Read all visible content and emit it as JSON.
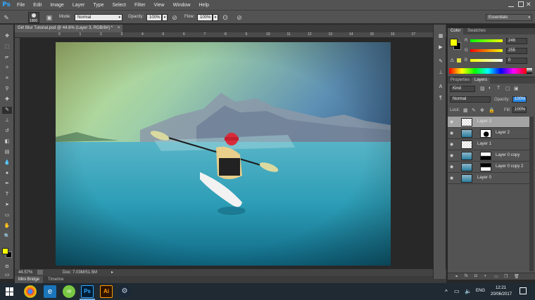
{
  "menubar": {
    "logo": "Ps",
    "items": [
      "File",
      "Edit",
      "Image",
      "Layer",
      "Type",
      "Select",
      "Filter",
      "View",
      "Window",
      "Help"
    ]
  },
  "optionsbar": {
    "brush_size": "1900",
    "mode_label": "Mode:",
    "mode_value": "Normal",
    "opacity_label": "Opacity:",
    "opacity_value": "100%",
    "flow_label": "Flow:",
    "flow_value": "100%",
    "workspace": "Essentials"
  },
  "document": {
    "tab_title": "Girl Blur Tutorial.psd @ 44.6% (Layer 3, RGB/8#) *",
    "ruler_ticks": [
      "0",
      "1",
      "2",
      "3",
      "4",
      "5",
      "6",
      "7",
      "8",
      "9",
      "10",
      "11",
      "12",
      "13",
      "14",
      "15",
      "16",
      "17"
    ],
    "zoom": "44.57%",
    "doc_info": "Doc: 7.03M/51.5M"
  },
  "bottom_tabs": [
    "Mini Bridge",
    "Timeline"
  ],
  "color_panel": {
    "tabs": [
      "Color",
      "Swatches"
    ],
    "r_label": "R",
    "r_value": "246",
    "g_label": "G",
    "g_value": "255",
    "b_label": "B",
    "b_value": "0",
    "foreground": "#f6ff00",
    "background": "#000000"
  },
  "layers_panel": {
    "tabs": [
      "Properties",
      "Layers"
    ],
    "filter_kind": "Kind",
    "blend_mode": "Normal",
    "opacity_label": "Opacity:",
    "opacity_value": "100%",
    "lock_label": "Lock:",
    "fill_label": "Fill:",
    "fill_value": "100%",
    "layers": [
      {
        "name": "Layer 3",
        "selected": true,
        "mask": false
      },
      {
        "name": "Layer 2",
        "selected": false,
        "mask": true
      },
      {
        "name": "Layer 1",
        "selected": false,
        "mask": false
      },
      {
        "name": "Layer 0 copy",
        "selected": false,
        "mask": true
      },
      {
        "name": "Layer 0 copy 2",
        "selected": false,
        "mask": true
      },
      {
        "name": "Layer 0",
        "selected": false,
        "mask": false
      }
    ]
  },
  "taskbar": {
    "language": "ENG",
    "time": "12:21",
    "date": "20/06/2017"
  }
}
